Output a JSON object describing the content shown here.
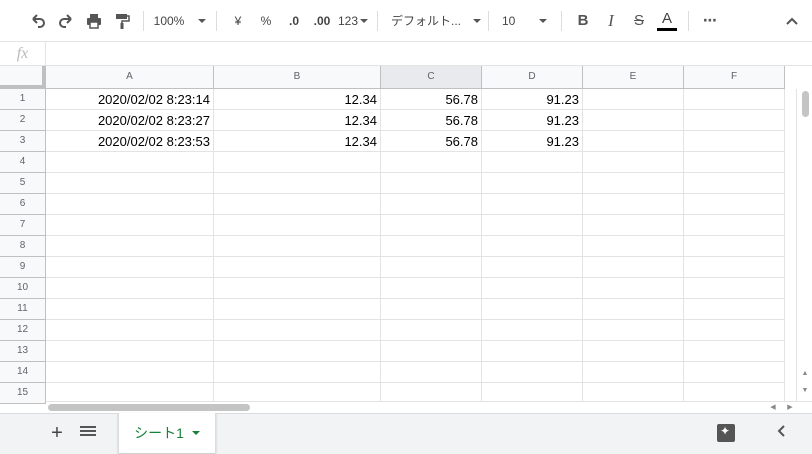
{
  "toolbar": {
    "zoom": "100%",
    "currency": "¥",
    "percent": "%",
    "dec_decrease": ".0",
    "dec_increase": ".00",
    "more_formats": "123",
    "font": "デフォルト...",
    "font_size": "10",
    "bold": "B",
    "italic": "I",
    "strike": "S",
    "text_color_letter": "A",
    "text_color": "#000000",
    "more": "⋯"
  },
  "formula_bar": {
    "fx": "fx",
    "value": ""
  },
  "columns": [
    "A",
    "B",
    "C",
    "D",
    "E",
    "F"
  ],
  "active_column": "C",
  "rows": [
    "1",
    "2",
    "3",
    "4",
    "5",
    "6",
    "7",
    "8",
    "9",
    "10",
    "11",
    "12",
    "13",
    "14",
    "15"
  ],
  "cells": [
    [
      "2020/02/02 8:23:14",
      "12.34",
      "56.78",
      "91.23",
      "",
      ""
    ],
    [
      "2020/02/02 8:23:27",
      "12.34",
      "56.78",
      "91.23",
      "",
      ""
    ],
    [
      "2020/02/02 8:23:53",
      "12.34",
      "56.78",
      "91.23",
      "",
      ""
    ]
  ],
  "sheet_tabs": [
    {
      "label": "シート1",
      "active": true
    }
  ],
  "colors": {
    "accent": "#188038",
    "header_bg": "#f8f9fa",
    "grid_line": "#e2e3e3"
  }
}
